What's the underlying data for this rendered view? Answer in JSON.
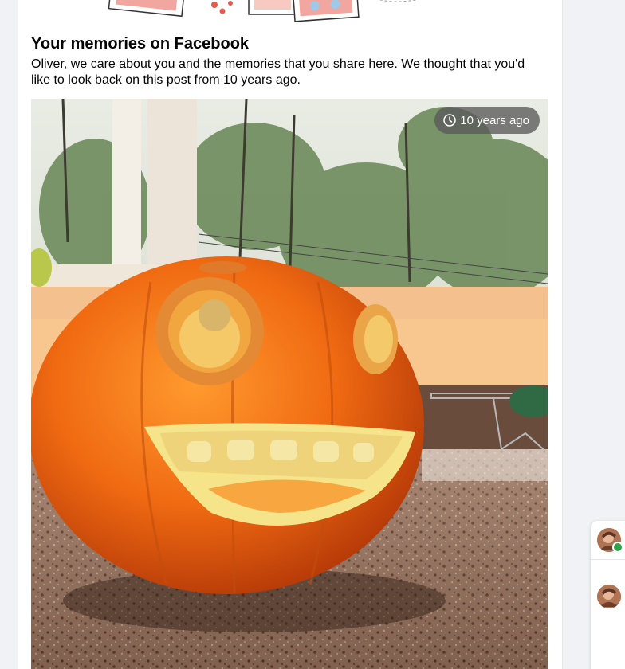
{
  "memory_card": {
    "title": "Your memories on Facebook",
    "description": "Oliver, we care about you and the memories that you share here. We thought that you'd like to look back on this post from 10 years ago.",
    "badge": {
      "icon": "clock-icon",
      "text": "10 years ago"
    },
    "photo": {
      "subject": "carved-pumpkin-photo"
    }
  },
  "contacts_rail": {
    "contacts": [
      {
        "icon": "contact-avatar",
        "online": true
      },
      {
        "icon": "contact-avatar",
        "online": false
      }
    ]
  },
  "colors": {
    "page_background": "#f0f2f5",
    "card_background": "#ffffff",
    "online_green": "#31a24c"
  }
}
